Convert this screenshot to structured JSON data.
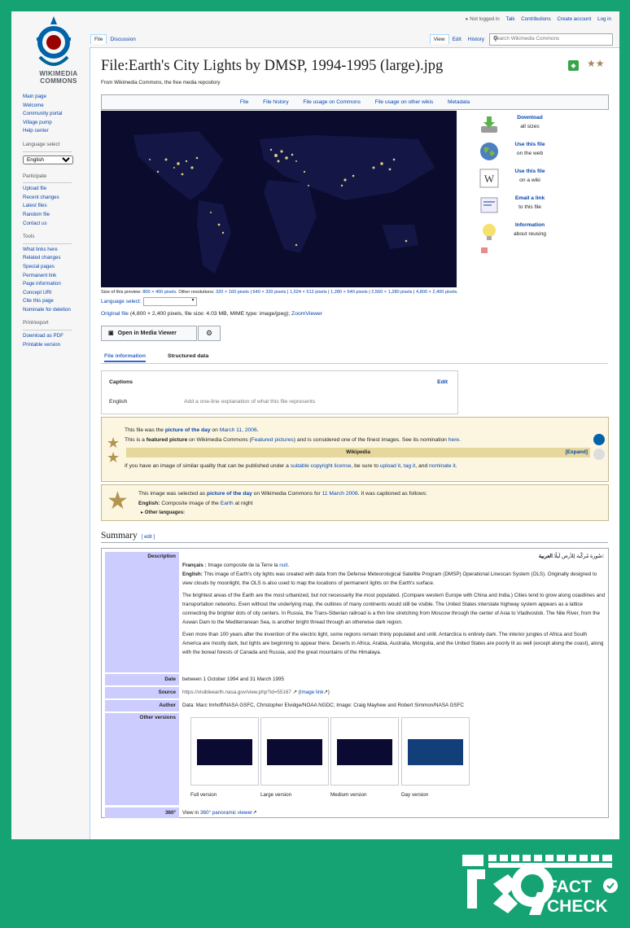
{
  "logo": {
    "line1": "WIKIMEDIA",
    "line2": "COMMONS"
  },
  "top_links": [
    "Not logged in",
    "Talk",
    "Contributions",
    "Create account",
    "Log in"
  ],
  "tabs_left": [
    "File",
    "Discussion"
  ],
  "tabs_right": [
    "View",
    "Edit",
    "History"
  ],
  "search": {
    "placeholder": "Search Wikimedia Commons"
  },
  "sidebar": {
    "main": [
      "Main page",
      "Welcome",
      "Community portal",
      "Village pump",
      "Help center"
    ],
    "language_select_label": "Language select",
    "language_value": "English",
    "participate_title": "Participate",
    "participate": [
      "Upload file",
      "Recent changes",
      "Latest files",
      "Random file",
      "Contact us"
    ],
    "tools_title": "Tools",
    "tools": [
      "What links here",
      "Related changes",
      "Special pages",
      "Permanent link",
      "Page information",
      "Concept URI",
      "Cite this page",
      "Nominate for deletion"
    ],
    "print_title": "Print/export",
    "print": [
      "Download as PDF",
      "Printable version"
    ]
  },
  "page": {
    "title": "File:Earth's City Lights by DMSP, 1994-1995 (large).jpg",
    "from": "From Wikimedia Commons, the free media repository"
  },
  "file_toc": [
    "File",
    "File history",
    "File usage on Commons",
    "File usage on other wikis",
    "Metadata"
  ],
  "actions": [
    {
      "title": "Download",
      "sub": "all sizes",
      "icon": "download-icon"
    },
    {
      "title": "Use this file",
      "sub": "on the web",
      "icon": "globe-icon"
    },
    {
      "title": "Use this file",
      "sub": "on a wiki",
      "icon": "wikipedia-icon"
    },
    {
      "title": "Email a link",
      "sub": "to this file",
      "icon": "email-icon"
    },
    {
      "title": "Information",
      "sub": "about reusing",
      "icon": "lightbulb-icon"
    }
  ],
  "size_info": {
    "prefix": "Size of this preview: ",
    "preview": "800 × 400 pixels",
    "mid": ". Other resolutions: ",
    "resolutions": [
      "320 × 160 pixels",
      "640 × 320 pixels",
      "1,024 × 512 pixels",
      "1,280 × 640 pixels",
      "2,560 × 1,280 pixels",
      "4,800 × 2,400 pixels"
    ]
  },
  "language_select_inline": "Language select:",
  "original": {
    "link": "Original file",
    "details": "(4,800 × 2,400 pixels, file size: 4.03 MB, MIME type: image/jpeg); ",
    "zoom": "ZoomViewer"
  },
  "media_viewer_button": "Open in Media Viewer",
  "subtabs": [
    "File information",
    "Structured data"
  ],
  "captions": {
    "title": "Captions",
    "edit": "Edit",
    "lang": "English",
    "placeholder": "Add a one-line explanation of what this file represents"
  },
  "featured": {
    "p1_a": "This file was the ",
    "p1_link": "picture of the day",
    "p1_b": " on ",
    "p1_date": "March 11, 2006",
    "p1_c": ".",
    "p2_a": "This is a ",
    "p2_bold": "featured picture",
    "p2_b": " on Wikimedia Commons (",
    "p2_link": "Featured pictures",
    "p2_c": ") and is considered one of the finest images. See its nomination ",
    "p2_here": "here",
    "p2_d": ".",
    "bar": "Wikipedia",
    "expand": "[Expand]",
    "p3_a": "If you have an image of similar quality that can be published under a ",
    "p3_link1": "suitable copyright license",
    "p3_b": ", be sure to ",
    "p3_link2": "upload it",
    "p3_c": ", ",
    "p3_link3": "tag it",
    "p3_d": ", and ",
    "p3_link4": "nominate it",
    "p3_e": "."
  },
  "potd": {
    "a": "This image was selected as ",
    "link": "picture of the day",
    "b": " on Wikimedia Commons for ",
    "date": "11 March 2006",
    "c": ". It was captioned as follows:",
    "en_label": "English:",
    "en_a": " Composite image of the ",
    "en_link": "Earth",
    "en_b": " at night",
    "other": "Other languages:"
  },
  "summary": {
    "heading": "Summary",
    "edit": "[ edit ]",
    "desc_label": "Description",
    "arabic_label": "العربية:",
    "arabic_text": " صُورة مُركّبة لِلأرض لَيلًا.",
    "fr_label": "Français :",
    "fr_text": " Image composite de la Terre la ",
    "fr_link": "nuit",
    "en_label": "English:",
    "en_text": " This image of Earth's city lights was created with data from the Defense Meteorological Satellite Program (DMSP) Operational Linescan System (OLS). Originally designed to view clouds by moonlight, the OLS is also used to map the locations of permanent lights on the Earth's surface.",
    "para2": "The brightest areas of the Earth are the most urbanized, but not necessarily the most populated. (Compare western Europe with China and India.) Cities tend to grow along coastlines and transportation networks. Even without the underlying map, the outlines of many continents would still be visible. The United States interstate highway system appears as a lattice connecting the brighter dots of city centers. In Russia, the Trans-Siberian railroad is a thin line stretching from Moscow through the center of Asia to Vladivostok. The Nile River, from the Aswan Dam to the Mediterranean Sea, is another bright thread through an otherwise dark region.",
    "para3": "Even more than 100 years after the invention of the electric light, some regions remain thinly populated and unlit. Antarctica is entirely dark. The interior jungles of Africa and South America are mostly dark, but lights are beginning to appear there. Deserts in Africa, Arabia, Australia, Mongolia, and the United States are poorly lit as well (except along the coast), along with the boreal forests of Canada and Russia, and the great mountains of the Himalaya.",
    "date_label": "Date",
    "date": "between 1 October 1994 and 31 March 1995",
    "source_label": "Source",
    "source_url": "https://visibleearth.nasa.gov/view.php?id=55167",
    "source_link": "Image link",
    "author_label": "Author",
    "author": "Data: Marc Imhoff/NASA GSFC, Christopher Elvidge/NOAA NGDC; Image: Craig Mayhew and Robert Simmon/NASA GSFC",
    "other_label": "Other versions",
    "versions": [
      "Full version",
      "Large version",
      "Medium version",
      "Day version"
    ],
    "v360_label": "360°",
    "v360_a": "View in ",
    "v360_link": "360° panoramic viewer"
  },
  "fact_check": {
    "top": "FACT",
    "bottom": "CHECK"
  }
}
